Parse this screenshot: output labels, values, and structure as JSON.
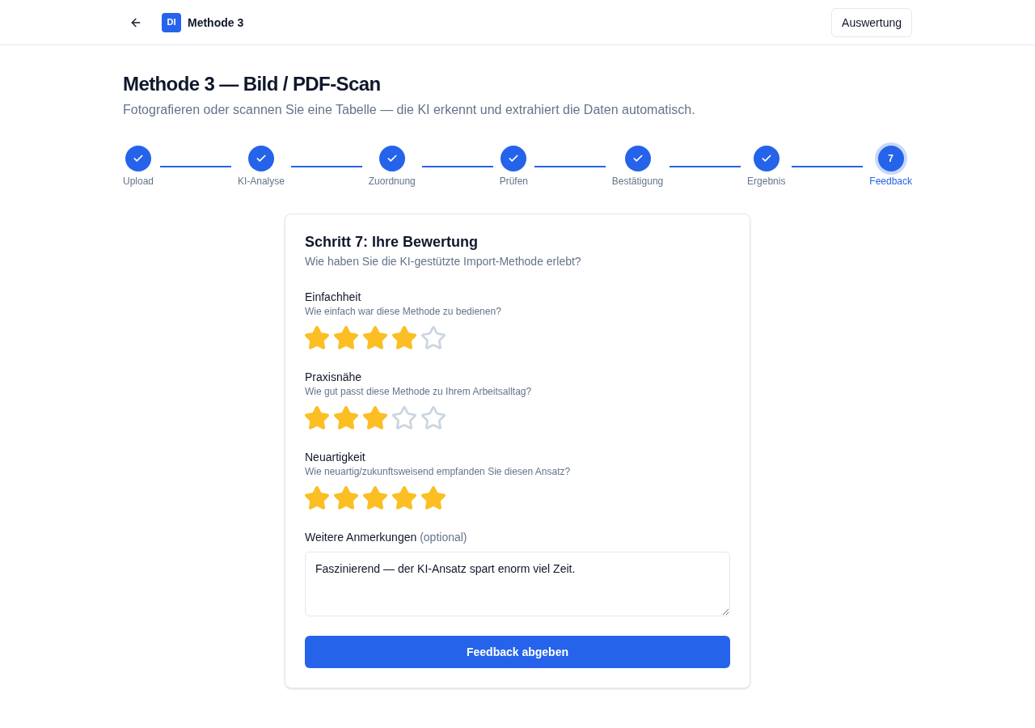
{
  "header": {
    "logo": "DI",
    "title": "Methode 3",
    "button": "Auswertung"
  },
  "page": {
    "title": "Methode 3 — Bild / PDF-Scan",
    "subtitle": "Fotografieren oder scannen Sie eine Tabelle — die KI erkennt und extrahiert die Daten automatisch."
  },
  "steps": [
    {
      "label": "Upload",
      "done": true,
      "selected": false
    },
    {
      "label": "KI-Analyse",
      "done": true,
      "selected": false
    },
    {
      "label": "Zuordnung",
      "done": true,
      "selected": false
    },
    {
      "label": "Prüfen",
      "done": true,
      "selected": false
    },
    {
      "label": "Bestätigung",
      "done": true,
      "selected": false
    },
    {
      "label": "Ergebnis",
      "done": true,
      "selected": false
    },
    {
      "label": "Feedback",
      "done": false,
      "selected": true,
      "number": "7"
    }
  ],
  "card": {
    "title": "Schritt 7: Ihre Bewertung",
    "subtitle": "Wie haben Sie die KI-gestützte Import-Methode erlebt?",
    "ratings": [
      {
        "label": "Einfachheit",
        "question": "Wie einfach war diese Methode zu bedienen?",
        "stars": 4
      },
      {
        "label": "Praxisnähe",
        "question": "Wie gut passt diese Methode zu Ihrem Arbeitsalltag?",
        "stars": 3
      },
      {
        "label": "Neuartigkeit",
        "question": "Wie neuartig/zukunftsweisend empfanden Sie diesen Ansatz?",
        "stars": 5
      }
    ],
    "comment": {
      "label": "Weitere Anmerkungen",
      "hint": "(optional)",
      "value": "Faszinierend — der KI-Ansatz spart enorm viel Zeit."
    },
    "submit": "Feedback abgeben"
  }
}
